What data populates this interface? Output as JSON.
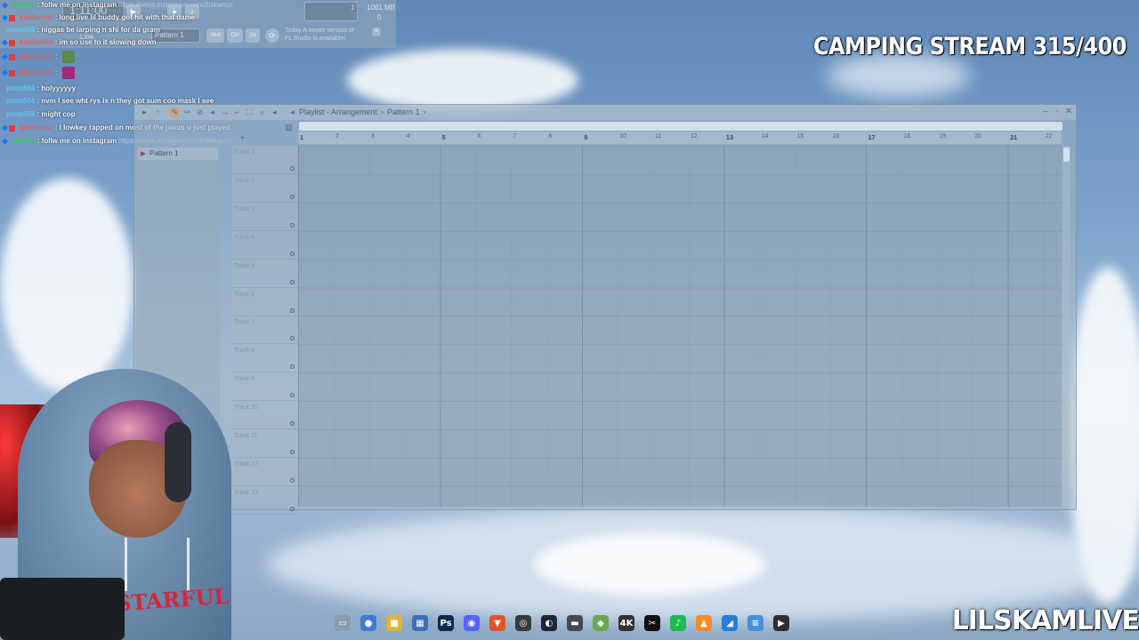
{
  "overlay": {
    "stream_title": "CAMPING STREAM 315/400",
    "channel_name": "LILSKAMLIVE"
  },
  "fl_toolbar": {
    "time": "1:11:00",
    "cpu_line1": "1",
    "memory": "1061 MB",
    "cpu_line2": "0",
    "mode": "Line",
    "pattern": "Pattern 1",
    "shift_label": "Shift",
    "ctrl_label": "Ctrl",
    "alt_label": "Alt",
    "hint_line1": "Today  A newer version of",
    "hint_line2": "FL Studio is available!"
  },
  "chat": [
    {
      "user": "BotRix",
      "color": "#32c95c",
      "badges": [
        "mod"
      ],
      "msg": ": follw me on instagram",
      "link": "https://www.instagram.com/lilskamz/"
    },
    {
      "user": "konkorror",
      "color": "#e85a5a",
      "badges": [
        "mod",
        "red"
      ],
      "msg": ": long live lil buddy got hit with that dame"
    },
    {
      "user": "pints556",
      "color": "#59c7e8",
      "badges": [],
      "msg": ": niggas be larping n shi for da gram"
    },
    {
      "user": "konkorror",
      "color": "#e85a5a",
      "badges": [
        "mod",
        "red"
      ],
      "msg": ": im so use to it slowing down"
    },
    {
      "user": "konkorror",
      "color": "#e85a5a",
      "badges": [
        "mod",
        "red"
      ],
      "msg": ":",
      "emote": "#5a8a4a"
    },
    {
      "user": "konkorror",
      "color": "#e85a5a",
      "badges": [
        "mod",
        "red"
      ],
      "msg": ":",
      "emote": "#a02a7a"
    },
    {
      "user": "pints556",
      "color": "#59c7e8",
      "badges": [],
      "msg": ": holyyyyyy"
    },
    {
      "user": "pints556",
      "color": "#59c7e8",
      "badges": [],
      "msg": ": nvm I see wht rys is n they got sum coo mask I see"
    },
    {
      "user": "pints556",
      "color": "#59c7e8",
      "badges": [],
      "msg": ": might cop"
    },
    {
      "user": "konkorror",
      "color": "#e85a5a",
      "badges": [
        "mod",
        "red"
      ],
      "msg": ": I lowkey rapped on most of the joints u just played"
    },
    {
      "user": "BotRix",
      "color": "#32c95c",
      "badges": [
        "mod"
      ],
      "msg": ": follw me on instagram",
      "link": "https://www.instagram.com/lilskamz/"
    }
  ],
  "playlist": {
    "title": "Playlist - Arrangement",
    "pattern": "Pattern 1",
    "pattern_list": [
      "Pattern 1"
    ],
    "ruler": [
      "1",
      "2",
      "3",
      "4",
      "5",
      "6",
      "7",
      "8",
      "9",
      "10",
      "11",
      "12",
      "13",
      "14",
      "15",
      "16",
      "17",
      "18",
      "19",
      "20",
      "21",
      "22"
    ],
    "tracks": [
      "Track 1",
      "Track 2",
      "Track 3",
      "Track 4",
      "Track 5",
      "Track 6",
      "Track 7",
      "Track 8",
      "Track 9",
      "Track 10",
      "Track 11",
      "Track 12",
      "Track 13"
    ]
  },
  "webcam": {
    "shirt_text": "STARFUL"
  },
  "taskbar": [
    {
      "name": "task-view-icon",
      "color": "#8a9bb0",
      "glyph": "▭"
    },
    {
      "name": "chrome-icon",
      "color": "#3a7bd5",
      "glyph": "●"
    },
    {
      "name": "file-explorer-icon",
      "color": "#e3b23c",
      "glyph": "■"
    },
    {
      "name": "store-icon",
      "color": "#3d6fb5",
      "glyph": "▦"
    },
    {
      "name": "photoshop-icon",
      "color": "#0f2a4d",
      "glyph": "Ps"
    },
    {
      "name": "discord-icon",
      "color": "#5865f2",
      "glyph": "◉"
    },
    {
      "name": "brave-icon",
      "color": "#e0532b",
      "glyph": "▼"
    },
    {
      "name": "obs-icon",
      "color": "#3a3a3a",
      "glyph": "◎"
    },
    {
      "name": "steam-icon",
      "color": "#1b2838",
      "glyph": "◐"
    },
    {
      "name": "app-icon",
      "color": "#444a55",
      "glyph": "▬"
    },
    {
      "name": "layers-icon",
      "color": "#6aa84f",
      "glyph": "◆"
    },
    {
      "name": "cover-icon",
      "color": "#333333",
      "glyph": "4K"
    },
    {
      "name": "capcut-icon",
      "color": "#111111",
      "glyph": "✂"
    },
    {
      "name": "spotify-icon",
      "color": "#1db954",
      "glyph": "♪"
    },
    {
      "name": "fl-studio-icon",
      "color": "#f28c28",
      "glyph": "▲"
    },
    {
      "name": "editor-icon",
      "color": "#2b7bd8",
      "glyph": "◢"
    },
    {
      "name": "notepad-icon",
      "color": "#4a90d9",
      "glyph": "≡"
    },
    {
      "name": "media-player-icon",
      "color": "#2e2e2e",
      "glyph": "▶"
    }
  ]
}
